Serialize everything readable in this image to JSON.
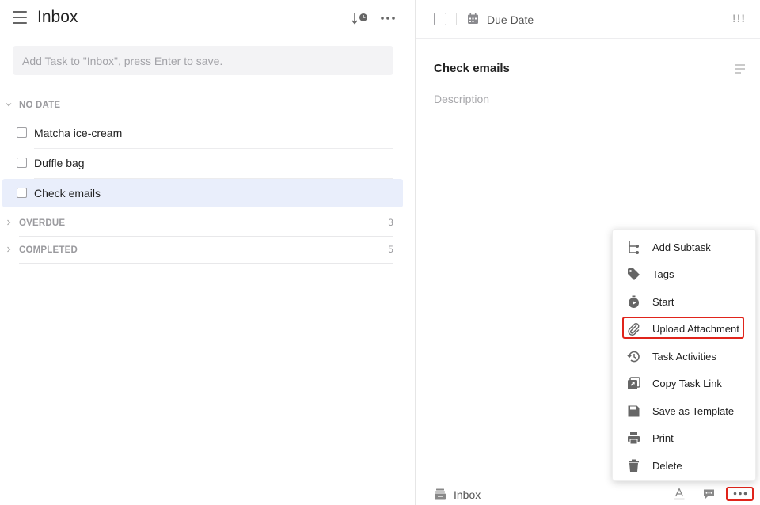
{
  "left": {
    "title": "Inbox",
    "add_task_placeholder": "Add Task to \"Inbox\", press Enter to save.",
    "sections": {
      "no_date": {
        "label": "NO DATE"
      },
      "overdue": {
        "label": "OVERDUE",
        "count": "3"
      },
      "completed": {
        "label": "COMPLETED",
        "count": "5"
      }
    },
    "tasks": [
      {
        "title": "Matcha ice-cream"
      },
      {
        "title": "Duffle bag"
      },
      {
        "title": "Check emails"
      }
    ]
  },
  "detail": {
    "due_date_label": "Due Date",
    "priority_label": "!!!",
    "task_title": "Check emails",
    "description_placeholder": "Description",
    "list_name": "Inbox"
  },
  "menu": {
    "items": [
      {
        "label": "Add Subtask",
        "icon": "subtask-icon"
      },
      {
        "label": "Tags",
        "icon": "tag-icon"
      },
      {
        "label": "Start",
        "icon": "timer-icon"
      },
      {
        "label": "Upload Attachment",
        "icon": "paperclip-icon"
      },
      {
        "label": "Task Activities",
        "icon": "history-icon"
      },
      {
        "label": "Copy Task Link",
        "icon": "link-copy-icon"
      },
      {
        "label": "Save as Template",
        "icon": "save-icon"
      },
      {
        "label": "Print",
        "icon": "printer-icon"
      },
      {
        "label": "Delete",
        "icon": "trash-icon"
      }
    ]
  },
  "colors": {
    "highlight": "#e0241b",
    "selected_row": "#e9eefb"
  }
}
